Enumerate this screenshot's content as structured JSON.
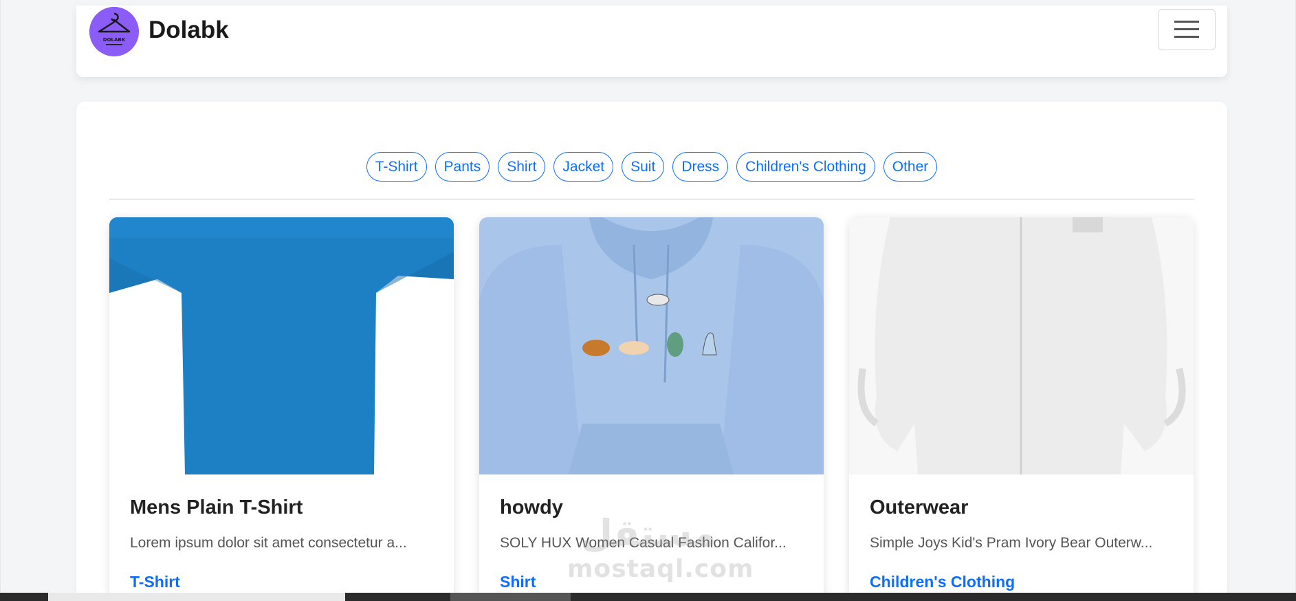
{
  "header": {
    "brand": "Dolabk",
    "logo_text": "DOLABK"
  },
  "filters": [
    "T-Shirt",
    "Pants",
    "Shirt",
    "Jacket",
    "Suit",
    "Dress",
    "Children's Clothing",
    "Other"
  ],
  "products": [
    {
      "title": "Mens Plain T-Shirt",
      "description": "Lorem ipsum dolor sit amet consectetur a...",
      "category": "T-Shirt",
      "image": "blue-tshirt"
    },
    {
      "title": "howdy",
      "description": "SOLY HUX Women Casual Fashion Califor...",
      "category": "Shirt",
      "image": "light-blue-hoodie-dinosaurs"
    },
    {
      "title": "Outerwear",
      "description": "Simple Joys Kid's Pram Ivory Bear Outerw...",
      "category": "Children's Clothing",
      "image": "ivory-fleece-suit"
    }
  ],
  "watermark": {
    "arabic": "مستقل",
    "latin": "mostaql.com"
  },
  "colors": {
    "accent": "#0d6efd",
    "logo_bg": "#8b5cf6"
  }
}
